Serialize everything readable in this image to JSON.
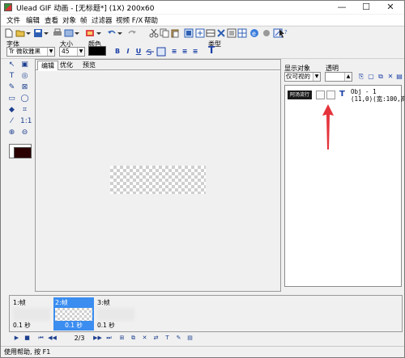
{
  "window": {
    "title": "Ulead GIF 动画 - [无标题*] (1X) 200x60",
    "min_glyph": "—",
    "max_glyph": "☐",
    "close_glyph": "✕"
  },
  "menubar": {
    "items": [
      "文件",
      "编辑",
      "查看",
      "对象",
      "帧",
      "过滤器",
      "视频 F/X",
      "帮助"
    ]
  },
  "toolbar": {
    "icons": [
      "new-file-icon",
      "open-file-icon",
      "dropdown-icon",
      "save-icon",
      "dropdown-icon",
      "print-icon",
      "export-icon",
      "dropdown-icon",
      "undo-icon",
      "redo-icon",
      "cut-icon",
      "copy-icon",
      "paste-icon",
      "image-icon",
      "add-frame-icon",
      "duplicate-icon",
      "delete-icon",
      "grid-icon",
      "web-icon",
      "crop-icon",
      "resize-icon",
      "help-icon"
    ]
  },
  "text_toolbar": {
    "font_label": "字体",
    "font_value": "Tr 微软雅黑",
    "size_label": "大小",
    "size_value": "45",
    "color_label": "颜色",
    "color_value": "#000000",
    "type_label": "类型",
    "bold": "B",
    "italic": "I",
    "underline": "U",
    "align": [
      "≡",
      "≡",
      "≡"
    ]
  },
  "editor": {
    "tabs": [
      "编辑",
      "优化",
      "预览"
    ],
    "active_tab": "编辑"
  },
  "object_panel": {
    "show_label": "显示对象",
    "opacity_label": "透明",
    "visibility_value": "仅可视的",
    "object": {
      "thumb_text": "阿汤流行",
      "line1": "Obj - 1",
      "line2": "(11,0)(宽:100,高:"
    }
  },
  "frames": [
    {
      "label": "1:帧",
      "delay": "0.1 秒",
      "selected": false
    },
    {
      "label": "2:帧",
      "delay": "0.1 秒",
      "selected": true
    },
    {
      "label": "3:帧",
      "delay": "0.1 秒",
      "selected": false
    }
  ],
  "playback": {
    "counter": "2/3"
  },
  "status": {
    "text": "使用帮助, 按 F1"
  },
  "colors": {
    "selection": "#3b8df0",
    "annotation_arrow": "#e5333b",
    "accent_icons": "#1b3fa6"
  }
}
